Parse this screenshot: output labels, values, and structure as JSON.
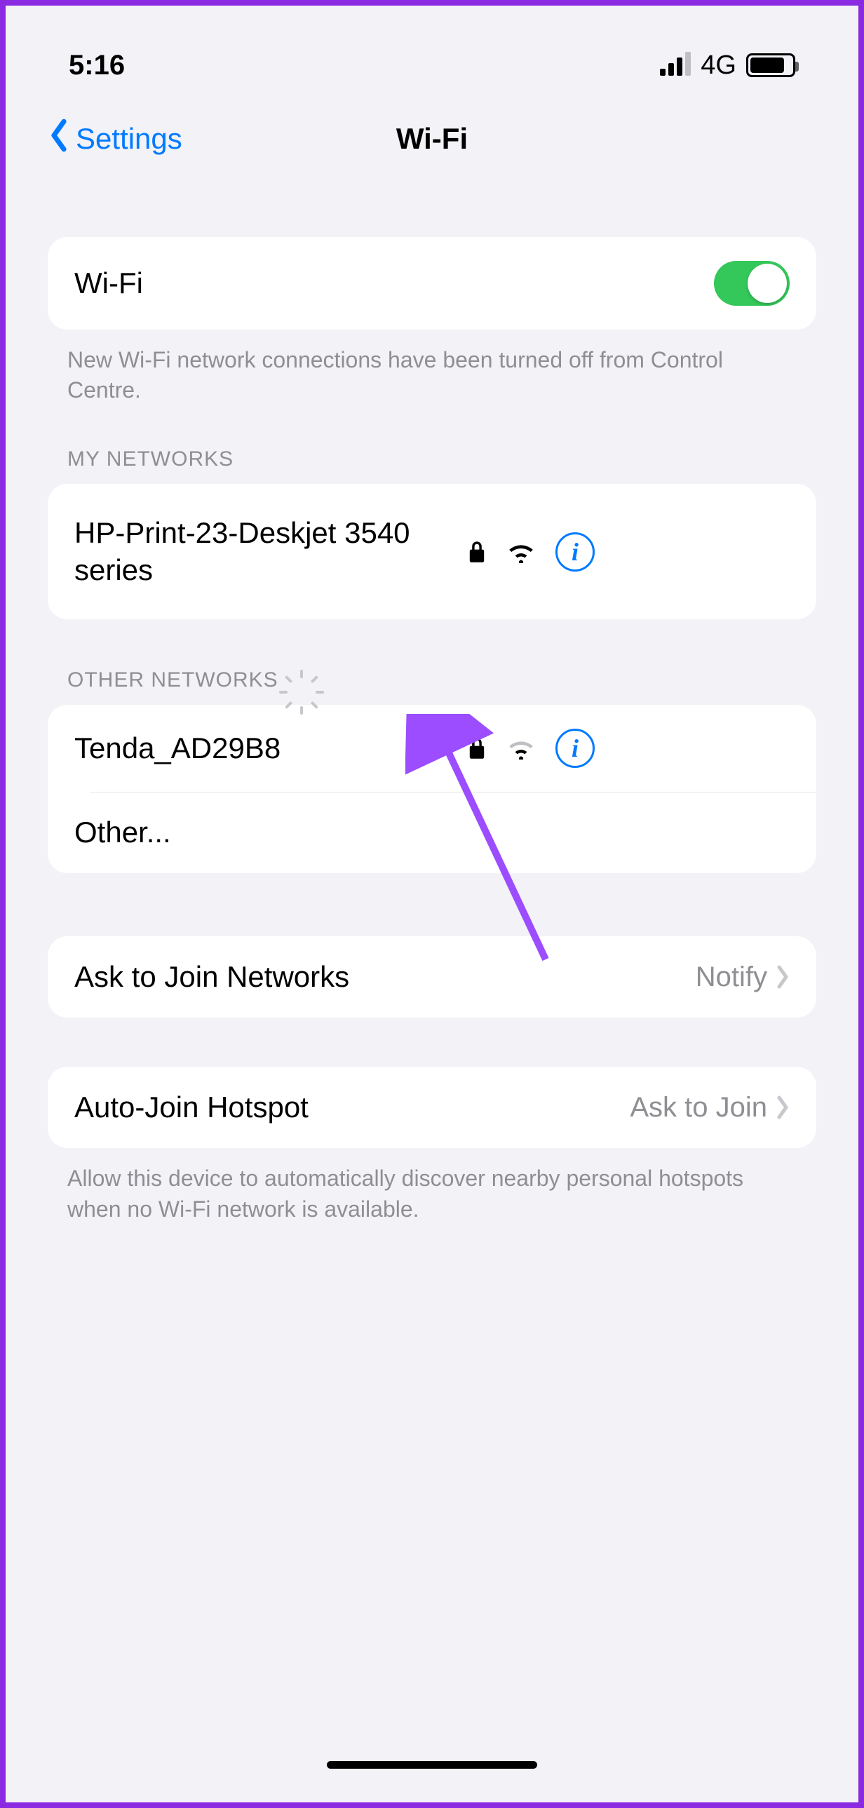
{
  "status": {
    "time": "5:16",
    "network_label": "4G"
  },
  "nav": {
    "back_label": "Settings",
    "title": "Wi-Fi"
  },
  "wifi_row": {
    "label": "Wi-Fi"
  },
  "wifi_note": "New Wi-Fi network connections have been turned off from Control Centre.",
  "my_networks": {
    "header": "MY NETWORKS",
    "items": [
      {
        "name": "HP-Print-23-Deskjet 3540 series",
        "secured": true
      }
    ]
  },
  "other_networks": {
    "header": "OTHER NETWORKS",
    "items": [
      {
        "name": "Tenda_AD29B8",
        "secured": true
      }
    ],
    "other_label": "Other..."
  },
  "ask_join": {
    "label": "Ask to Join Networks",
    "value": "Notify"
  },
  "auto_join": {
    "label": "Auto-Join Hotspot",
    "value": "Ask to Join",
    "note": "Allow this device to automatically discover nearby personal hotspots when no Wi-Fi network is available."
  }
}
